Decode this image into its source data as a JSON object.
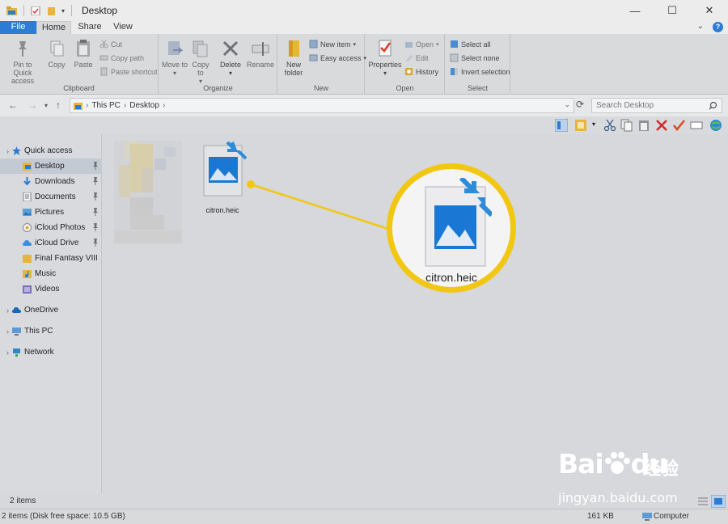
{
  "window": {
    "title": "Desktop",
    "minimize_glyph": "—",
    "maximize_glyph": "☐",
    "close_glyph": "✕"
  },
  "tabs": {
    "file": "File",
    "home": "Home",
    "share": "Share",
    "view": "View"
  },
  "ribbon": {
    "clipboard": {
      "label": "Clipboard",
      "pin": "Pin to Quick access",
      "copy": "Copy",
      "paste": "Paste",
      "cut": "Cut",
      "copy_path": "Copy path",
      "paste_shortcut": "Paste shortcut"
    },
    "organize": {
      "label": "Organize",
      "move_to": "Move to",
      "copy_to": "Copy to",
      "delete": "Delete",
      "rename": "Rename"
    },
    "new": {
      "label": "New",
      "new_folder": "New folder",
      "new_item": "New item",
      "easy_access": "Easy access"
    },
    "open": {
      "label": "Open",
      "properties": "Properties",
      "open": "Open",
      "edit": "Edit",
      "history": "History"
    },
    "select": {
      "label": "Select",
      "select_all": "Select all",
      "select_none": "Select none",
      "invert": "Invert selection"
    }
  },
  "address": {
    "crumbs": [
      "This PC",
      "Desktop"
    ],
    "search_placeholder": "Search Desktop"
  },
  "nav": {
    "quick_access": "Quick access",
    "items": [
      "Desktop",
      "Downloads",
      "Documents",
      "Pictures",
      "iCloud Photos",
      "iCloud Drive",
      "Final Fantasy VIII",
      "Music",
      "Videos"
    ],
    "onedrive": "OneDrive",
    "this_pc": "This PC",
    "network": "Network"
  },
  "file": {
    "name": "citron.heic"
  },
  "callout": {
    "name": "citron.heic"
  },
  "status": {
    "items": "2 items",
    "detail": "2 items (Disk free space: 10.5 GB)",
    "size": "161 KB",
    "location": "Computer"
  },
  "watermark": {
    "brand": "Bai",
    "brand2": "du",
    "cn": "经验",
    "url": "jingyan.baidu.com"
  },
  "colors": {
    "accent": "#2a7cd5",
    "highlight": "#f2c714",
    "image_icon": "#1a78d4"
  }
}
